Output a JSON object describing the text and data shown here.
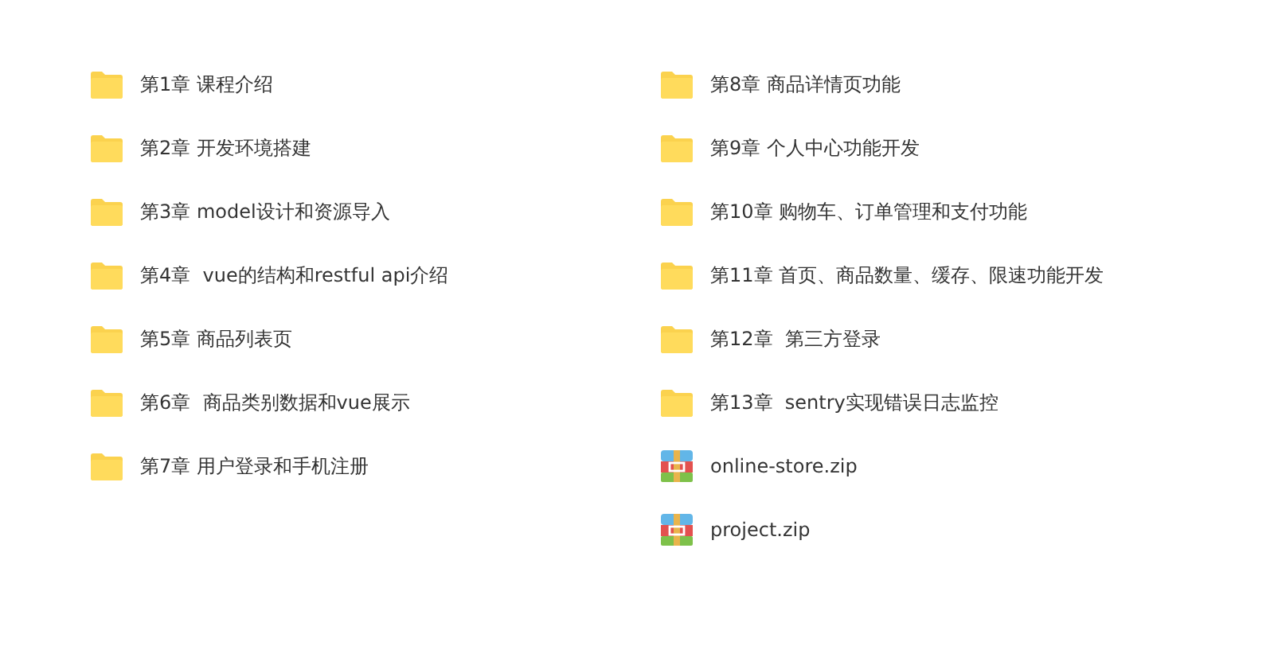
{
  "columns": [
    {
      "items": [
        {
          "kind": "folder",
          "name": "第1章 课程介绍"
        },
        {
          "kind": "folder",
          "name": "第2章 开发环境搭建"
        },
        {
          "kind": "folder",
          "name": "第3章 model设计和资源导入"
        },
        {
          "kind": "folder",
          "name": "第4章  vue的结构和restful api介绍"
        },
        {
          "kind": "folder",
          "name": "第5章 商品列表页"
        },
        {
          "kind": "folder",
          "name": "第6章  商品类别数据和vue展示"
        },
        {
          "kind": "folder",
          "name": "第7章 用户登录和手机注册"
        }
      ]
    },
    {
      "items": [
        {
          "kind": "folder",
          "name": "第8章 商品详情页功能"
        },
        {
          "kind": "folder",
          "name": "第9章 个人中心功能开发"
        },
        {
          "kind": "folder",
          "name": "第10章 购物车、订单管理和支付功能"
        },
        {
          "kind": "folder",
          "name": "第11章 首页、商品数量、缓存、限速功能开发"
        },
        {
          "kind": "folder",
          "name": "第12章  第三方登录"
        },
        {
          "kind": "folder",
          "name": "第13章  sentry实现错误日志监控"
        },
        {
          "kind": "zip",
          "name": "online-store.zip"
        },
        {
          "kind": "zip",
          "name": "project.zip"
        }
      ]
    }
  ]
}
